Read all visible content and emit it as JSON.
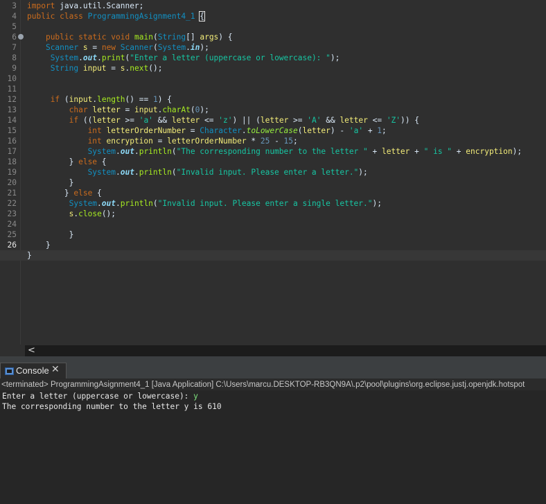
{
  "editor": {
    "lines": [
      {
        "n": "3",
        "tokens": [
          [
            "kw",
            "import"
          ],
          [
            "plain",
            " java.util.Scanner;"
          ]
        ]
      },
      {
        "n": "4",
        "tokens": [
          [
            "kw",
            "public"
          ],
          [
            "plain",
            " "
          ],
          [
            "kw",
            "class"
          ],
          [
            "plain",
            " "
          ],
          [
            "ty",
            "ProgrammingAsignment4_1"
          ],
          [
            "plain",
            " "
          ],
          [
            "brk",
            "{"
          ]
        ]
      },
      {
        "n": "5",
        "tokens": []
      },
      {
        "n": "6",
        "tokens": [
          [
            "plain",
            "    "
          ],
          [
            "kw",
            "public"
          ],
          [
            "plain",
            " "
          ],
          [
            "kw",
            "static"
          ],
          [
            "plain",
            " "
          ],
          [
            "kw",
            "void"
          ],
          [
            "plain",
            " "
          ],
          [
            "mth",
            "main"
          ],
          [
            "plain",
            "("
          ],
          [
            "ty",
            "String"
          ],
          [
            "plain",
            "[] "
          ],
          [
            "var",
            "args"
          ],
          [
            "plain",
            ") {"
          ]
        ]
      },
      {
        "n": "7",
        "tokens": [
          [
            "plain",
            "    "
          ],
          [
            "ty",
            "Scanner"
          ],
          [
            "plain",
            " "
          ],
          [
            "var",
            "s"
          ],
          [
            "plain",
            " = "
          ],
          [
            "kw",
            "new"
          ],
          [
            "plain",
            " "
          ],
          [
            "ty",
            "Scanner"
          ],
          [
            "plain",
            "("
          ],
          [
            "ty",
            "System"
          ],
          [
            "plain",
            "."
          ],
          [
            "fld",
            "in"
          ],
          [
            "plain",
            ");"
          ]
        ]
      },
      {
        "n": "8",
        "tokens": [
          [
            "plain",
            "     "
          ],
          [
            "ty",
            "System"
          ],
          [
            "plain",
            "."
          ],
          [
            "fld",
            "out"
          ],
          [
            "plain",
            "."
          ],
          [
            "mth",
            "print"
          ],
          [
            "plain",
            "("
          ],
          [
            "st",
            "\"Enter a letter (uppercase or lowercase): \""
          ],
          [
            "plain",
            ");"
          ]
        ]
      },
      {
        "n": "9",
        "tokens": [
          [
            "plain",
            "     "
          ],
          [
            "ty",
            "String"
          ],
          [
            "plain",
            " "
          ],
          [
            "var",
            "input"
          ],
          [
            "plain",
            " = "
          ],
          [
            "var",
            "s"
          ],
          [
            "plain",
            "."
          ],
          [
            "mth",
            "next"
          ],
          [
            "plain",
            "();"
          ]
        ]
      },
      {
        "n": "10",
        "tokens": []
      },
      {
        "n": "11",
        "tokens": []
      },
      {
        "n": "12",
        "tokens": [
          [
            "plain",
            "     "
          ],
          [
            "kw",
            "if"
          ],
          [
            "plain",
            " ("
          ],
          [
            "var",
            "input"
          ],
          [
            "plain",
            "."
          ],
          [
            "mth",
            "length"
          ],
          [
            "plain",
            "() == "
          ],
          [
            "num",
            "1"
          ],
          [
            "plain",
            ") {"
          ]
        ]
      },
      {
        "n": "13",
        "tokens": [
          [
            "plain",
            "         "
          ],
          [
            "kw",
            "char"
          ],
          [
            "plain",
            " "
          ],
          [
            "var",
            "letter"
          ],
          [
            "plain",
            " = "
          ],
          [
            "var",
            "input"
          ],
          [
            "plain",
            "."
          ],
          [
            "mth",
            "charAt"
          ],
          [
            "plain",
            "("
          ],
          [
            "num",
            "0"
          ],
          [
            "plain",
            ");"
          ]
        ]
      },
      {
        "n": "14",
        "tokens": [
          [
            "plain",
            "         "
          ],
          [
            "kw",
            "if"
          ],
          [
            "plain",
            " (("
          ],
          [
            "var",
            "letter"
          ],
          [
            "plain",
            " >= "
          ],
          [
            "st",
            "'a'"
          ],
          [
            "plain",
            " && "
          ],
          [
            "var",
            "letter"
          ],
          [
            "plain",
            " <= "
          ],
          [
            "st",
            "'z'"
          ],
          [
            "plain",
            ") || ("
          ],
          [
            "var",
            "letter"
          ],
          [
            "plain",
            " >= "
          ],
          [
            "st",
            "'A'"
          ],
          [
            "plain",
            " && "
          ],
          [
            "var",
            "letter"
          ],
          [
            "plain",
            " <= "
          ],
          [
            "st",
            "'Z'"
          ],
          [
            "plain",
            ")) {"
          ]
        ]
      },
      {
        "n": "15",
        "tokens": [
          [
            "plain",
            "             "
          ],
          [
            "kw",
            "int"
          ],
          [
            "plain",
            " "
          ],
          [
            "var",
            "letterOrderNumber"
          ],
          [
            "plain",
            " = "
          ],
          [
            "ty",
            "Character"
          ],
          [
            "plain",
            "."
          ],
          [
            "smth",
            "toLowerCase"
          ],
          [
            "plain",
            "("
          ],
          [
            "var",
            "letter"
          ],
          [
            "plain",
            ") - "
          ],
          [
            "st",
            "'a'"
          ],
          [
            "plain",
            " + "
          ],
          [
            "num",
            "1"
          ],
          [
            "plain",
            ";"
          ]
        ]
      },
      {
        "n": "16",
        "tokens": [
          [
            "plain",
            "             "
          ],
          [
            "kw",
            "int"
          ],
          [
            "plain",
            " "
          ],
          [
            "var",
            "encryption"
          ],
          [
            "plain",
            " = "
          ],
          [
            "var",
            "letterOrderNumber"
          ],
          [
            "plain",
            " * "
          ],
          [
            "num",
            "25"
          ],
          [
            "plain",
            " - "
          ],
          [
            "num",
            "15"
          ],
          [
            "plain",
            ";"
          ]
        ]
      },
      {
        "n": "17",
        "tokens": [
          [
            "plain",
            "             "
          ],
          [
            "ty",
            "System"
          ],
          [
            "plain",
            "."
          ],
          [
            "fld",
            "out"
          ],
          [
            "plain",
            "."
          ],
          [
            "mth",
            "println"
          ],
          [
            "plain",
            "("
          ],
          [
            "st",
            "\"The corresponding number to the letter \""
          ],
          [
            "plain",
            " + "
          ],
          [
            "var",
            "letter"
          ],
          [
            "plain",
            " + "
          ],
          [
            "st",
            "\" is \""
          ],
          [
            "plain",
            " + "
          ],
          [
            "var",
            "encryption"
          ],
          [
            "plain",
            ");"
          ]
        ]
      },
      {
        "n": "18",
        "tokens": [
          [
            "plain",
            "         } "
          ],
          [
            "kw",
            "else"
          ],
          [
            "plain",
            " {"
          ]
        ]
      },
      {
        "n": "19",
        "tokens": [
          [
            "plain",
            "             "
          ],
          [
            "ty",
            "System"
          ],
          [
            "plain",
            "."
          ],
          [
            "fld",
            "out"
          ],
          [
            "plain",
            "."
          ],
          [
            "mth",
            "println"
          ],
          [
            "plain",
            "("
          ],
          [
            "st",
            "\"Invalid input. Please enter a letter.\""
          ],
          [
            "plain",
            ");"
          ]
        ]
      },
      {
        "n": "20",
        "tokens": [
          [
            "plain",
            "         }"
          ]
        ]
      },
      {
        "n": "21",
        "tokens": [
          [
            "plain",
            "        } "
          ],
          [
            "kw",
            "else"
          ],
          [
            "plain",
            " {"
          ]
        ]
      },
      {
        "n": "22",
        "tokens": [
          [
            "plain",
            "         "
          ],
          [
            "ty",
            "System"
          ],
          [
            "plain",
            "."
          ],
          [
            "fld",
            "out"
          ],
          [
            "plain",
            "."
          ],
          [
            "mth",
            "println"
          ],
          [
            "plain",
            "("
          ],
          [
            "st",
            "\"Invalid input. Please enter a single letter.\""
          ],
          [
            "plain",
            ");"
          ]
        ]
      },
      {
        "n": "23",
        "tokens": [
          [
            "plain",
            "         "
          ],
          [
            "var",
            "s"
          ],
          [
            "plain",
            "."
          ],
          [
            "mth",
            "close"
          ],
          [
            "plain",
            "();"
          ]
        ]
      },
      {
        "n": "24",
        "tokens": []
      },
      {
        "n": "25",
        "tokens": [
          [
            "plain",
            "         }"
          ]
        ]
      },
      {
        "n": "26",
        "tokens": [
          [
            "plain",
            "    }"
          ]
        ]
      },
      {
        "n": "27",
        "tokens": [
          [
            "plain",
            "}"
          ]
        ]
      }
    ],
    "line_numbers_shown": [
      "3",
      "4",
      "5",
      "6",
      "7",
      "8",
      "9",
      "10",
      "11",
      "12",
      "13",
      "14",
      "15",
      "16",
      "17",
      "18",
      "19",
      "20",
      "21",
      "22",
      "23",
      "24",
      "25",
      "26"
    ]
  },
  "hscroll": {
    "left_arrow": "<"
  },
  "console": {
    "tab_label": "Console",
    "close_glyph": "✕",
    "status": "<terminated> ProgrammingAsignment4_1 [Java Application] C:\\Users\\marcu.DESKTOP-RB3QN9A\\.p2\\pool\\plugins\\org.eclipse.justj.openjdk.hotspot",
    "prompt": "Enter a letter (uppercase or lowercase): ",
    "user_input": "y",
    "result": "The corresponding number to the letter y is 610"
  },
  "colors": {
    "keyword": "#cc6c1d",
    "type": "#1290c3",
    "string": "#17c6a3",
    "method": "#a7ec21",
    "variable": "#f3ec79",
    "field": "#8ddaf8",
    "console_input": "#7fe57f"
  }
}
